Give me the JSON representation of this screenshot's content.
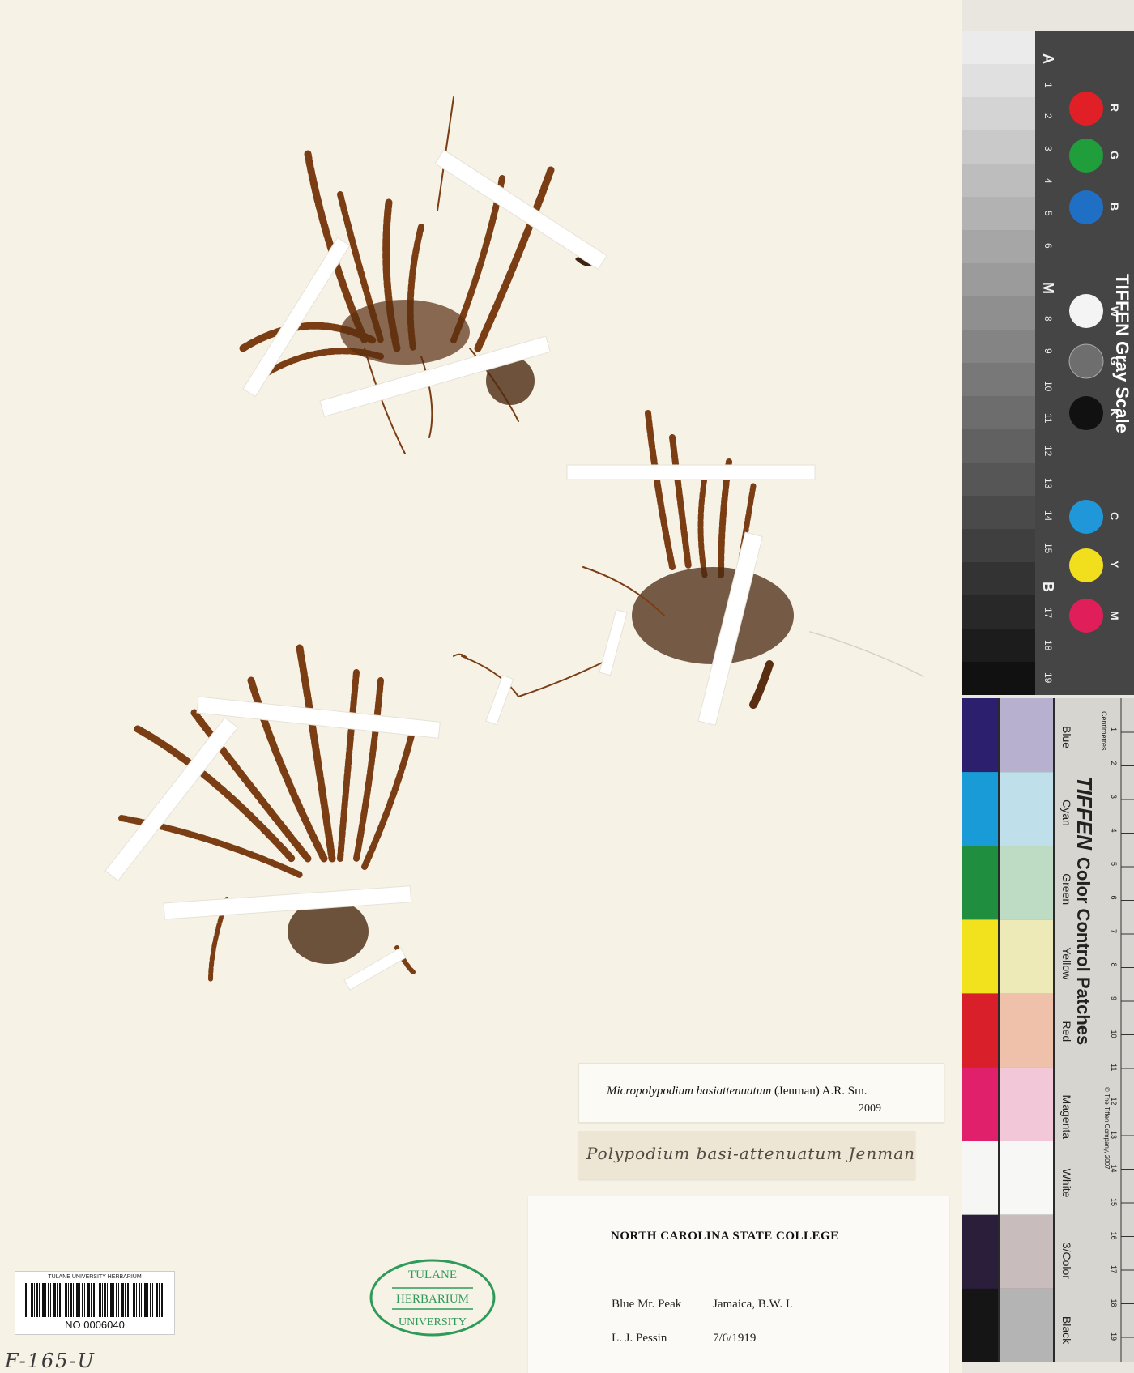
{
  "determination": {
    "taxon_italic": "Micropolypodium basiattenuatum",
    "authority": "(Jenman) A.R. Sm.",
    "year": "2009"
  },
  "original_label": {
    "handwritten": "Polypodium basi-attenuatum Jenman"
  },
  "collection_label": {
    "institution": "NORTH CAROLINA STATE COLLEGE",
    "locality_left": "Blue Mr. Peak",
    "locality_right": "Jamaica, B.W. I.",
    "collector": "L. J. Pessin",
    "date": "7/6/1919"
  },
  "barcode": {
    "header": "TULANE UNIVERSITY HERBARIUM",
    "number": "NO 0006040"
  },
  "stamp": {
    "top": "TULANE",
    "middle": "HERBARIUM",
    "bottom": "UNIVERSITY",
    "color": "#2f9a5a"
  },
  "handwritten_note": "F-165-U",
  "gray_scale": {
    "brand": "TIFFEN Gray Scale",
    "letters": [
      "A",
      "M",
      "B"
    ],
    "numbers": [
      "1",
      "2",
      "3",
      "4",
      "5",
      "6",
      "8",
      "9",
      "10",
      "11",
      "12",
      "13",
      "14",
      "15",
      "17",
      "18",
      "19"
    ],
    "patch_letters": [
      "R",
      "G",
      "B",
      "W",
      "G",
      "K",
      "C",
      "Y",
      "M"
    ],
    "patch_colors": [
      "#e01f26",
      "#1f9e3b",
      "#1f6fc4",
      "#f4f4f4",
      "#6e6e6e",
      "#111111",
      "#1f97d9",
      "#f1df1d",
      "#e01e5a"
    ]
  },
  "color_control": {
    "brand": "TIFFEN",
    "title": "Color Control Patches",
    "unit": "Centimetres",
    "copyright": "© The Tiffen Company, 2007",
    "swatch_labels": [
      "Blue",
      "Cyan",
      "Green",
      "Yellow",
      "Red",
      "Magenta",
      "White",
      "3/Color",
      "Black"
    ],
    "dark_colors": [
      "#2b1f6e",
      "#199bd8",
      "#1f8e3f",
      "#f2e21e",
      "#d9202a",
      "#e0206b",
      "#f6f6f4",
      "#2a1e3a",
      "#151515"
    ],
    "light_colors": [
      "#b8b0cf",
      "#bfe0ea",
      "#bedbc3",
      "#eeeab8",
      "#efc1aa",
      "#f2c8d8",
      "#f7f7f5",
      "#c8bcbc",
      "#b4b4b4"
    ],
    "numbers": [
      "1",
      "2",
      "3",
      "4",
      "5",
      "6",
      "7",
      "8",
      "9",
      "10",
      "11",
      "12",
      "13",
      "14",
      "15",
      "16",
      "17",
      "18",
      "19"
    ]
  }
}
